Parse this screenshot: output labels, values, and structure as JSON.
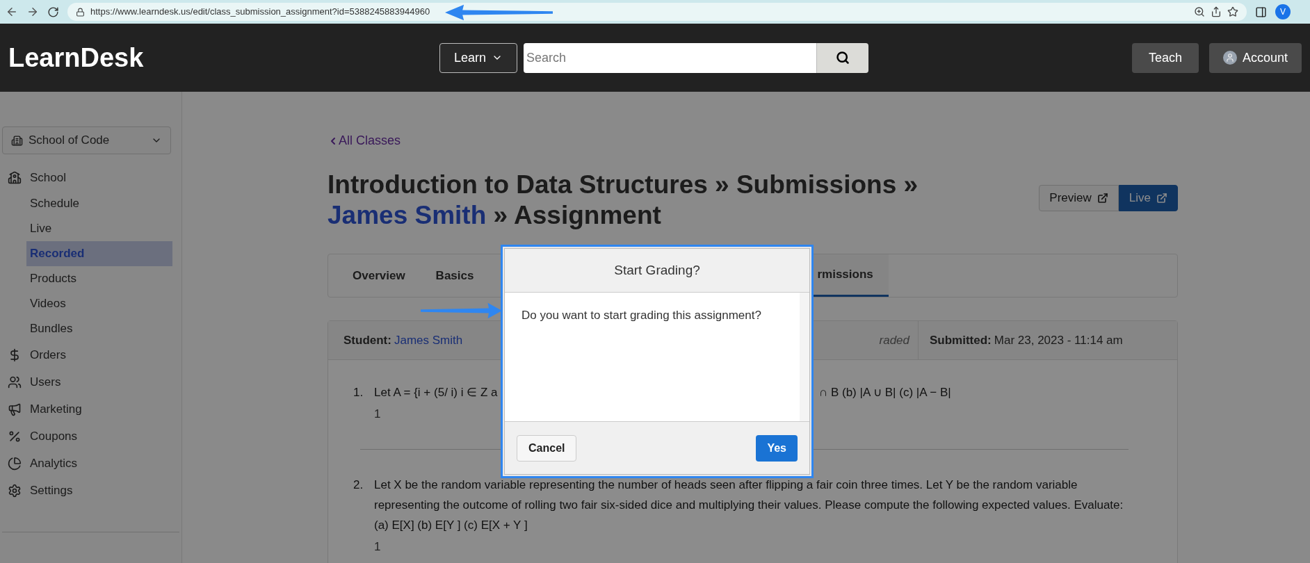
{
  "browser": {
    "url": "https://www.learndesk.us/edit/class_submission_assignment?id=5388245883944960",
    "profile_initial": "V"
  },
  "header": {
    "logo": "LearnDesk",
    "menu": "Learn",
    "search_placeholder": "Search",
    "teach": "Teach",
    "account": "Account"
  },
  "sidebar": {
    "school": "School of Code",
    "items": [
      {
        "label": "School",
        "kind": "school",
        "children": [
          {
            "label": "Schedule",
            "selected": false
          },
          {
            "label": "Live",
            "selected": false
          },
          {
            "label": "Recorded",
            "selected": true
          },
          {
            "label": "Products",
            "selected": false
          },
          {
            "label": "Videos",
            "selected": false
          },
          {
            "label": "Bundles",
            "selected": false
          }
        ]
      },
      {
        "label": "Orders",
        "kind": "dollar"
      },
      {
        "label": "Users",
        "kind": "users"
      },
      {
        "label": "Marketing",
        "kind": "megaphone"
      },
      {
        "label": "Coupons",
        "kind": "percent"
      },
      {
        "label": "Analytics",
        "kind": "pie"
      },
      {
        "label": "Settings",
        "kind": "gear"
      }
    ]
  },
  "back_link": "All Classes",
  "title": [
    {
      "text": "Introduction to Data Structures » Submissions » ",
      "link": false
    },
    {
      "text": "James Smith",
      "link": true
    },
    {
      "text": " » Assignment",
      "link": false
    }
  ],
  "view_buttons": [
    {
      "label": "Preview",
      "selected": false
    },
    {
      "label": "Live",
      "selected": true
    }
  ],
  "tabs": [
    {
      "label": "Overview",
      "selected": false
    },
    {
      "label": "Basics",
      "selected": false
    },
    {
      "label": "rmissions",
      "selected": true
    }
  ],
  "submission": {
    "student_label": "Student:",
    "student": "James Smith",
    "status": "raded",
    "submitted_label": "Submitted:",
    "submitted": "Mar 23, 2023 - 11:14 am"
  },
  "questions": [
    {
      "number": "1.",
      "parts": [
        "Let A = {i + (5/ i)  i ∈ Z a",
        "∩ B (b) |A ∪ B| (c) |A − B|"
      ],
      "answer": "1"
    },
    {
      "number": "2.",
      "parts": [
        "Let X be the random variable representing the number of heads seen after flipping a fair coin three times. Let Y be the random variable representing the outcome of rolling two fair six-sided dice and multiplying their values. Please compute the following expected values. Evaluate: (a) E[X] (b) E[Y ] (c) E[X + Y ]"
      ],
      "answer": "1"
    }
  ],
  "dialog": {
    "title": "Start Grading?",
    "message": "Do you want to start grading this assignment?",
    "buttons": [
      {
        "label": "Cancel",
        "kind": "secondary"
      },
      {
        "label": "Yes",
        "kind": "primary"
      }
    ]
  }
}
